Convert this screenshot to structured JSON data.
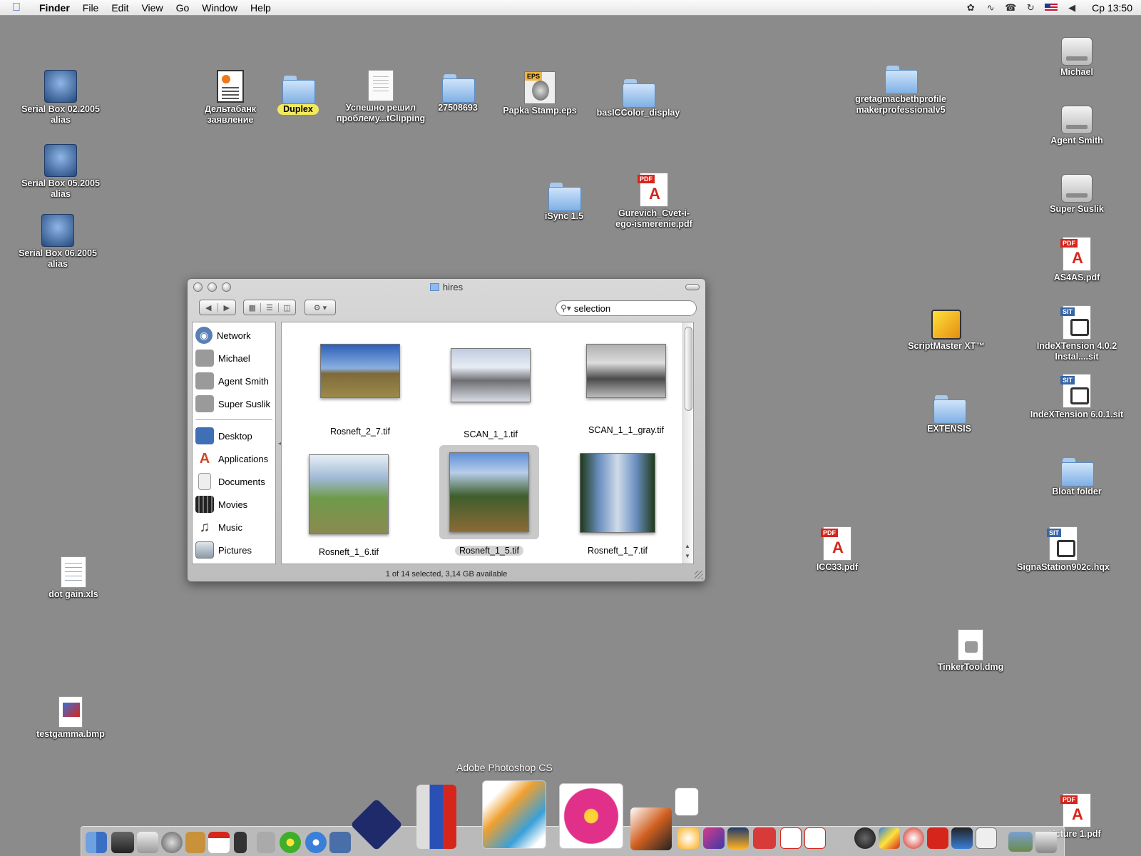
{
  "menubar": {
    "items": [
      "Finder",
      "File",
      "Edit",
      "View",
      "Go",
      "Window",
      "Help"
    ],
    "clock": "Ср 13:50"
  },
  "desktop": {
    "icons": [
      {
        "label": "Serial Box 02.2005\nalias",
        "icon": "serialbox-alias-icon"
      },
      {
        "label": "Serial Box 05.2005\nalias",
        "icon": "serialbox-alias-icon"
      },
      {
        "label": "Serial Box 06.2005\nalias",
        "icon": "serialbox-alias-icon"
      },
      {
        "label": "Дельтабанк\nзаявление",
        "icon": "form-document-icon"
      },
      {
        "label": "Duplex",
        "icon": "folder-icon"
      },
      {
        "label": "Успешно решил\nпроблему...tClipping",
        "icon": "text-clipping-icon"
      },
      {
        "label": "27508693",
        "icon": "folder-icon"
      },
      {
        "label": "Papka Stamp.eps",
        "icon": "eps-file-icon"
      },
      {
        "label": "basICColor_display",
        "icon": "folder-icon"
      },
      {
        "label": "gretagmacbethprofile\nmakerprofessionalv5",
        "icon": "folder-icon"
      },
      {
        "label": "iSync 1.5",
        "icon": "folder-icon"
      },
      {
        "label": "Gurevich_Cvet-i-\nego-ismerenie.pdf",
        "icon": "pdf-file-icon"
      },
      {
        "label": "Michael",
        "icon": "hard-drive-icon"
      },
      {
        "label": "Agent Smith",
        "icon": "hard-drive-icon"
      },
      {
        "label": "Super Suslik",
        "icon": "hard-drive-icon"
      },
      {
        "label": "AS4AS.pdf",
        "icon": "pdf-file-icon"
      },
      {
        "label": "ScriptMaster XT™",
        "icon": "scriptmaster-icon"
      },
      {
        "label": "IndeXTension 4.0.2\nInstal....sit",
        "icon": "sit-archive-icon"
      },
      {
        "label": "EXTENSIS",
        "icon": "folder-icon"
      },
      {
        "label": "IndeXTension 6.0.1.sit",
        "icon": "sit-archive-icon"
      },
      {
        "label": "Bloat folder",
        "icon": "folder-icon"
      },
      {
        "label": "ICC33.pdf",
        "icon": "pdf-file-icon"
      },
      {
        "label": "SignaStation902c.hqx",
        "icon": "hqx-archive-icon"
      },
      {
        "label": "dot gain.xls",
        "icon": "spreadsheet-icon"
      },
      {
        "label": "TinkerTool.dmg",
        "icon": "disk-image-icon"
      },
      {
        "label": "testgamma.bmp",
        "icon": "bmp-file-icon"
      },
      {
        "label": "icture 1.pdf",
        "icon": "pdf-file-icon"
      }
    ]
  },
  "finder": {
    "title": "hires",
    "search_value": "selection",
    "sidebar": [
      {
        "label": "Network",
        "icon": "network-globe-icon",
        "color": "#5a7fb5"
      },
      {
        "label": "Michael",
        "icon": "hard-drive-icon",
        "color": "#9a9a9a"
      },
      {
        "label": "Agent Smith",
        "icon": "hard-drive-icon",
        "color": "#9a9a9a"
      },
      {
        "label": "Super Suslik",
        "icon": "hard-drive-icon",
        "color": "#9a9a9a"
      },
      {
        "label": "Desktop",
        "icon": "desktop-icon",
        "color": "#3f6fb5"
      },
      {
        "label": "Applications",
        "icon": "applications-icon",
        "color": "#c94a2a"
      },
      {
        "label": "Documents",
        "icon": "documents-icon",
        "color": "#bdbdbd"
      },
      {
        "label": "Movies",
        "icon": "movies-icon",
        "color": "#333333"
      },
      {
        "label": "Music",
        "icon": "music-icon",
        "color": "#777777"
      },
      {
        "label": "Pictures",
        "icon": "pictures-icon",
        "color": "#8a9aa8"
      }
    ],
    "files": [
      {
        "label": "Rosneft_2_7.tif",
        "tone": "linear-gradient(#2d5fb8 0%,#8ab0e0 45%,#7e6a3a 55%,#9b8a4a 100%)"
      },
      {
        "label": "SCAN_1_1.tif",
        "tone": "linear-gradient(#bfcbe0 0%,#e8edf4 35%,#6e6e72 60%,#d8dde4 100%)"
      },
      {
        "label": "SCAN_1_1_gray.tif",
        "tone": "linear-gradient(#b0b0b0 0%,#dcdcdc 35%,#4a4a4a 65%,#bcbcbc 100%)"
      },
      {
        "label": "Rosneft_1_6.tif",
        "tone": "linear-gradient(#e6eef6 0%,#9fb8d4 30%,#6f9a4a 55%,#8a8a50 100%)"
      },
      {
        "label": "Rosneft_1_5.tif",
        "tone": "linear-gradient(#5d8fd6 0%,#b7cdea 25%,#3e5e2c 55%,#8a6a36 100%)"
      },
      {
        "label": "Rosneft_1_7.tif",
        "tone": "linear-gradient(90deg,#1f3a1a 0%,#6a8fc0 25%,#cfdbe8 50%,#6a8fc0 75%,#1f3a1a 100%)"
      }
    ],
    "selected_file": "Rosneft_1_5.tif",
    "status": "1 of 14 selected, 3,14 GB available"
  },
  "dock": {
    "hover_label": "Adobe Photoshop CS"
  }
}
